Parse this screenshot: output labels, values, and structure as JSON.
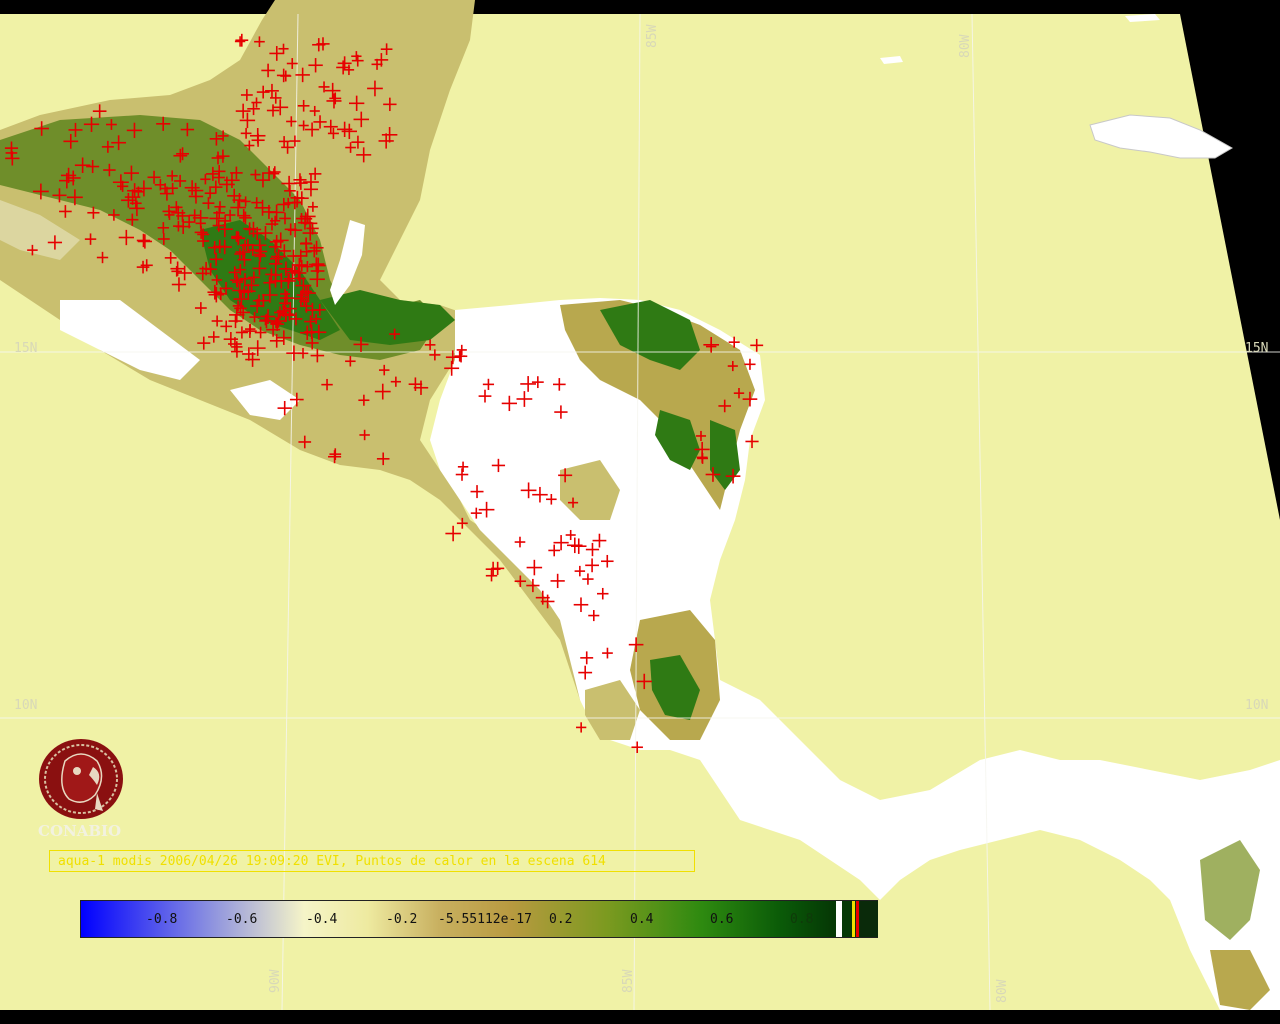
{
  "map": {
    "title": "aqua-1 modis 2006/04/26 19:09:20 EVI, Puntos de calor en la escena 614",
    "colors": {
      "background": "#000000",
      "ocean": "#f0f2a6",
      "cloud": "#ffffff",
      "hotspot": "#e60000",
      "title": "#f0e000"
    },
    "grid_labels": {
      "lon_85_top": "85W",
      "lon_80_top": "80W",
      "lat_15_left": "15N",
      "lat_15_right": "15N",
      "lat_10_left": "10N",
      "lat_10_right": "10N",
      "lon_90_bottom": "90W",
      "lon_85_bottom": "85W",
      "lon_80_bottom": "80W"
    },
    "hotspot_count": 614
  },
  "legend": {
    "ticks": [
      "-0.8",
      "-0.6",
      "-0.4",
      "-0.2",
      "-5.55112e-17",
      "0.2",
      "0.4",
      "0.6",
      "0.8"
    ],
    "range": [
      -1,
      1
    ]
  },
  "logo": {
    "icon": "conabio-macaw-logo",
    "text": "CONABIO"
  }
}
